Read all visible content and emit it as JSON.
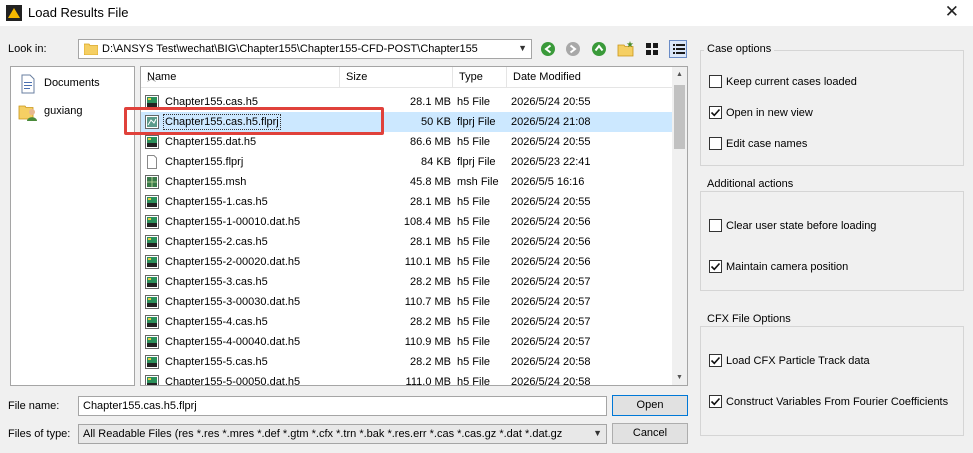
{
  "window": {
    "title": "Load Results File"
  },
  "look_in": {
    "label": "Look in:",
    "path": "D:\\ANSYS Test\\wechat\\BIG\\Chapter155\\Chapter155-CFD-POST\\Chapter155"
  },
  "toolbar": [
    "back-icon",
    "forward-icon",
    "parent-folder-icon",
    "new-folder-icon",
    "icon-view-icon",
    "detail-view-icon"
  ],
  "places": [
    {
      "label": "Documents",
      "icon": "documents-icon"
    },
    {
      "label": "guxiang",
      "icon": "user-folder-icon"
    }
  ],
  "columns": {
    "name": "Name",
    "size": "Size",
    "type": "Type",
    "date": "Date Modified"
  },
  "files": [
    {
      "name": "Chapter155.cas.h5",
      "size": "28.1 MB",
      "type": "h5 File",
      "date": "2026/5/24 20:55",
      "icon": "h5"
    },
    {
      "name": "Chapter155.cas.h5.flprj",
      "size": "50 KB",
      "type": "flprj File",
      "date": "2026/5/24 21:08",
      "icon": "flprj",
      "selected": true
    },
    {
      "name": "Chapter155.dat.h5",
      "size": "86.6 MB",
      "type": "h5 File",
      "date": "2026/5/24 20:55",
      "icon": "h5"
    },
    {
      "name": "Chapter155.flprj",
      "size": "84 KB",
      "type": "flprj File",
      "date": "2026/5/23 22:41",
      "icon": "blank"
    },
    {
      "name": "Chapter155.msh",
      "size": "45.8 MB",
      "type": "msh File",
      "date": "2026/5/5 16:16",
      "icon": "msh"
    },
    {
      "name": "Chapter155-1.cas.h5",
      "size": "28.1 MB",
      "type": "h5 File",
      "date": "2026/5/24 20:55",
      "icon": "h5"
    },
    {
      "name": "Chapter155-1-00010.dat.h5",
      "size": "108.4 MB",
      "type": "h5 File",
      "date": "2026/5/24 20:56",
      "icon": "h5"
    },
    {
      "name": "Chapter155-2.cas.h5",
      "size": "28.1 MB",
      "type": "h5 File",
      "date": "2026/5/24 20:56",
      "icon": "h5"
    },
    {
      "name": "Chapter155-2-00020.dat.h5",
      "size": "110.1 MB",
      "type": "h5 File",
      "date": "2026/5/24 20:56",
      "icon": "h5"
    },
    {
      "name": "Chapter155-3.cas.h5",
      "size": "28.2 MB",
      "type": "h5 File",
      "date": "2026/5/24 20:57",
      "icon": "h5"
    },
    {
      "name": "Chapter155-3-00030.dat.h5",
      "size": "110.7 MB",
      "type": "h5 File",
      "date": "2026/5/24 20:57",
      "icon": "h5"
    },
    {
      "name": "Chapter155-4.cas.h5",
      "size": "28.2 MB",
      "type": "h5 File",
      "date": "2026/5/24 20:57",
      "icon": "h5"
    },
    {
      "name": "Chapter155-4-00040.dat.h5",
      "size": "110.9 MB",
      "type": "h5 File",
      "date": "2026/5/24 20:57",
      "icon": "h5"
    },
    {
      "name": "Chapter155-5.cas.h5",
      "size": "28.2 MB",
      "type": "h5 File",
      "date": "2026/5/24 20:58",
      "icon": "h5"
    },
    {
      "name": "Chapter155-5-00050.dat.h5",
      "size": "111.0 MB",
      "type": "h5 File",
      "date": "2026/5/24 20:58",
      "icon": "h5"
    }
  ],
  "filename": {
    "label": "File name:",
    "value": "Chapter155.cas.h5.flprj"
  },
  "filetype": {
    "label": "Files of type:",
    "value": "All Readable Files (res *.res *.mres *.def *.gtm *.cfx *.trn *.bak *.res.err *.cas *.cas.gz *.dat *.dat.gz"
  },
  "buttons": {
    "open": "Open",
    "cancel": "Cancel"
  },
  "case_options": {
    "title": "Case options",
    "items": [
      {
        "label": "Keep current cases loaded",
        "checked": false
      },
      {
        "label": "Open in new view",
        "checked": true
      },
      {
        "label": "Edit case names",
        "checked": false
      }
    ]
  },
  "additional_actions": {
    "title": "Additional actions",
    "items": [
      {
        "label": "Clear user state before loading",
        "checked": false
      },
      {
        "label": "Maintain camera position",
        "checked": true
      }
    ]
  },
  "cfx_options": {
    "title": "CFX File Options",
    "items": [
      {
        "label": "Load CFX Particle Track data",
        "checked": true
      },
      {
        "label": "Construct Variables From Fourier Coefficients",
        "checked": true
      }
    ]
  },
  "colors": {
    "selection": "#cce8ff",
    "highlight_box": "#e0413b",
    "accent": "#0078d7"
  }
}
